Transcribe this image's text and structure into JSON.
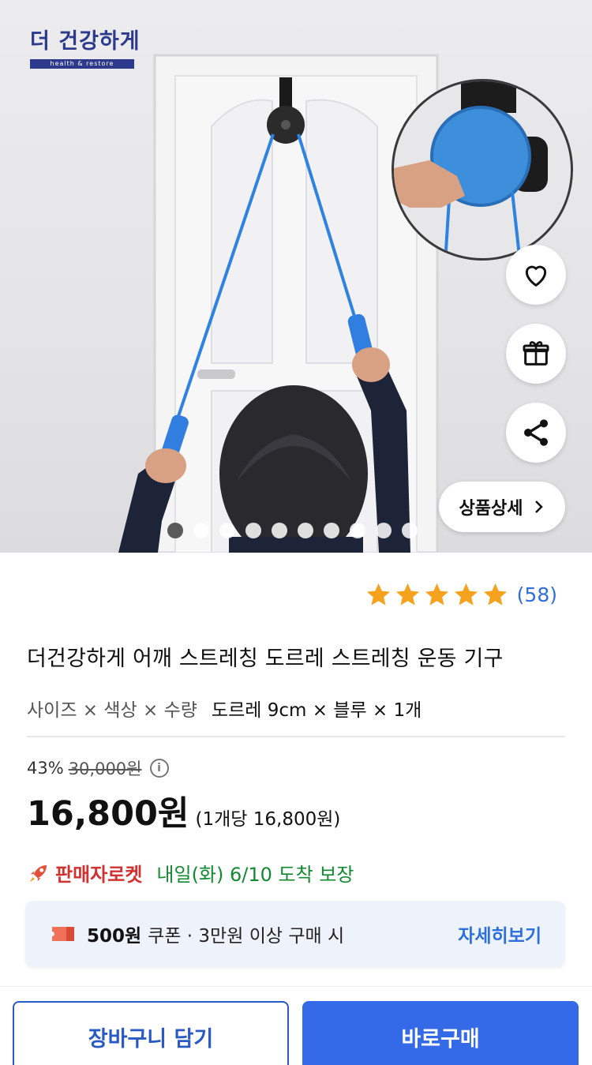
{
  "brand": {
    "name": "더 건강하게",
    "tagline": "health & restore"
  },
  "actions": {
    "wishlist_icon": "heart-icon",
    "gift_icon": "gift-icon",
    "share_icon": "share-icon",
    "detail_label": "상품상세"
  },
  "carousel": {
    "total": 10,
    "active_index": 0
  },
  "rating": {
    "stars": 5,
    "count": "(58)",
    "star_color": "#f5a31f"
  },
  "product": {
    "title": "더건강하게 어깨 스트레칭 도르레 스트레칭 운동 기구",
    "option_label": "사이즈 × 색상 × 수량",
    "option_value": "도르레 9cm × 블루 × 1개"
  },
  "pricing": {
    "discount": "43%",
    "original_price": "30,000원",
    "price": "16,800원",
    "unit_price": "(1개당 16,800원)"
  },
  "delivery": {
    "badge": "판매자로켓",
    "text": "내일(화) 6/10 도착 보장"
  },
  "coupon": {
    "amount": "500원",
    "description": "쿠폰 · 3만원 이상 구매 시",
    "more": "자세히보기"
  },
  "buttons": {
    "cart": "장바구니 담기",
    "buy": "바로구매"
  },
  "colors": {
    "accent_blue": "#3469e8",
    "link_blue": "#2f6fdc",
    "delivery_green": "#128a2f",
    "rocket_red": "#d13131"
  }
}
